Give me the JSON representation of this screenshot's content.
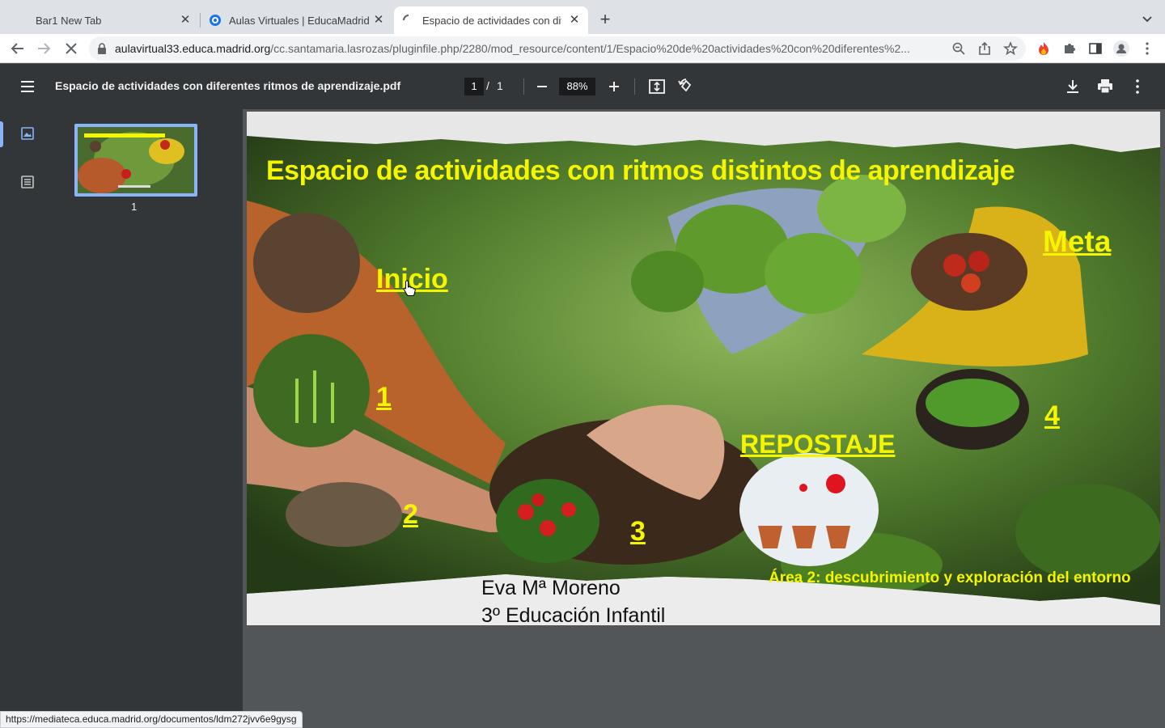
{
  "tabs": [
    {
      "title": "Bar1 New Tab",
      "active": false
    },
    {
      "title": "Aulas Virtuales | EducaMadrid",
      "active": false
    },
    {
      "title": "Espacio de actividades con dife",
      "active": true
    }
  ],
  "address_bar": {
    "host": "aulavirtual33.educa.madrid.org",
    "path": "/cc.santamaria.lasrozas/pluginfile.php/2280/mod_resource/content/1/Espacio%20de%20actividades%20con%20diferentes%2..."
  },
  "pdf_viewer": {
    "file_title": "Espacio de actividades con diferentes ritmos de aprendizaje.pdf",
    "current_page": "1",
    "page_separator": "/",
    "total_pages": "1",
    "zoom": "88%",
    "thumbnail_label": "1"
  },
  "slide": {
    "title": "Espacio de actividades con ritmos distintos de aprendizaje",
    "stages": {
      "inicio": "Inicio",
      "one": "1",
      "two": "2",
      "three": "3",
      "repostaje": "REPOSTAJE",
      "four": "4",
      "meta": "Meta"
    },
    "author_line1": "Eva Mª Moreno",
    "author_line2": "3º Educación Infantil",
    "area": "Área 2: descubrimiento y exploración del entorno"
  },
  "status_url": "https://mediateca.educa.madrid.org/documentos/ldm272jvv6e9gysg",
  "colors": {
    "tabstrip": "#dee1e6",
    "pdf_toolbar": "#323639",
    "pdf_background": "#525659",
    "slide_text_yellow": "#f5f500",
    "thumbnail_border": "#8ab4f8"
  }
}
